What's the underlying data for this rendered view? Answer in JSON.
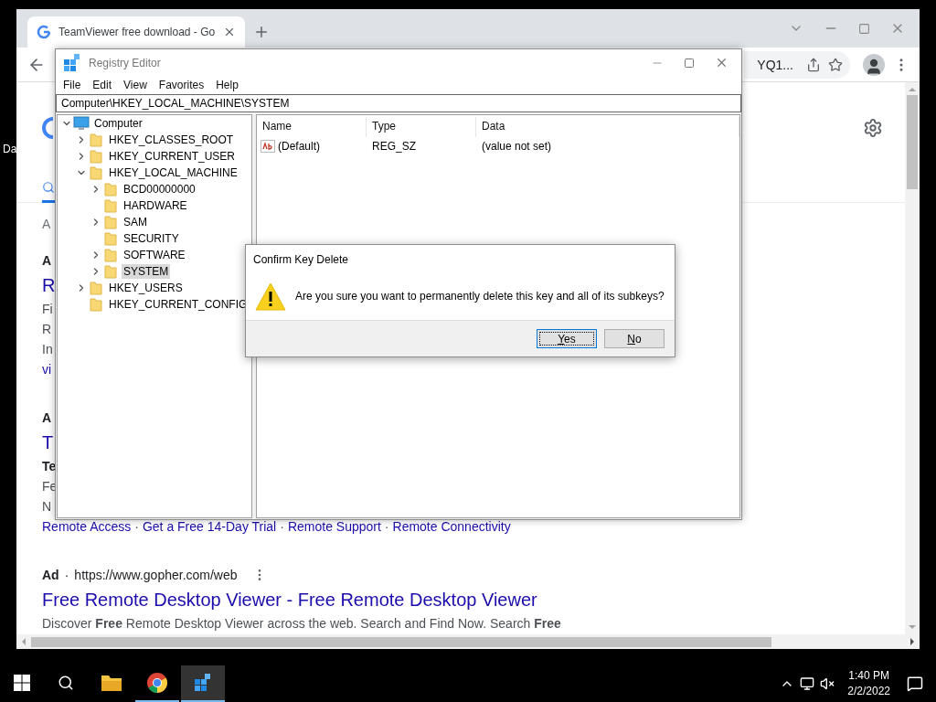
{
  "desktop": {
    "icon_labels": [
      "Da"
    ]
  },
  "browser": {
    "tab": {
      "title": "TeamViewer free download - Go",
      "selected": true
    },
    "address": "YQ1...",
    "page": {
      "summary": "A",
      "results": [
        {
          "ad_label": "A",
          "headline": "R",
          "lines": [
            {
              "kind": "text",
              "text": "Fi"
            },
            {
              "kind": "text",
              "text": "R"
            },
            {
              "kind": "text",
              "text": "In"
            },
            {
              "kind": "link",
              "text": "vi"
            }
          ]
        },
        {
          "ad_label": "A",
          "headline": "T",
          "lines": [
            {
              "kind": "bold",
              "text": "Te"
            },
            {
              "kind": "text",
              "text": "Fe"
            },
            {
              "kind": "text",
              "text": "N"
            },
            {
              "kind": "links",
              "separator": "·",
              "items": [
                "Remote Access",
                "Get a Free 14-Day Trial",
                "Remote Support",
                "Remote Connectivity"
              ]
            }
          ]
        },
        {
          "ad_label": "Ad",
          "separator": "·",
          "url": "https://www.gopher.com/web",
          "headline": "Free Remote Desktop Viewer - Free Remote Desktop Viewer",
          "lines": [
            {
              "kind": "text",
              "text": "Discover **Free** Remote Desktop Viewer across the web. Search and Find Now. Search **Free**"
            }
          ]
        }
      ]
    }
  },
  "regedit": {
    "title": "Registry Editor",
    "menu": [
      "File",
      "Edit",
      "View",
      "Favorites",
      "Help"
    ],
    "address": "Computer\\HKEY_LOCAL_MACHINE\\SYSTEM",
    "tree": [
      {
        "label": "Computer",
        "kind": "computer",
        "expandable": true,
        "expanded": true,
        "selected": false,
        "children": [
          {
            "label": "HKEY_CLASSES_ROOT",
            "kind": "folder",
            "expandable": true,
            "expanded": false,
            "selected": false
          },
          {
            "label": "HKEY_CURRENT_USER",
            "kind": "folder",
            "expandable": true,
            "expanded": false,
            "selected": false
          },
          {
            "label": "HKEY_LOCAL_MACHINE",
            "kind": "folder",
            "expandable": true,
            "expanded": true,
            "selected": false,
            "children": [
              {
                "label": "BCD00000000",
                "kind": "folder",
                "expandable": true,
                "expanded": false,
                "selected": false
              },
              {
                "label": "HARDWARE",
                "kind": "folder",
                "expandable": false,
                "selected": false
              },
              {
                "label": "SAM",
                "kind": "folder",
                "expandable": true,
                "expanded": false,
                "selected": false
              },
              {
                "label": "SECURITY",
                "kind": "folder",
                "expandable": false,
                "selected": false
              },
              {
                "label": "SOFTWARE",
                "kind": "folder",
                "expandable": true,
                "expanded": false,
                "selected": false
              },
              {
                "label": "SYSTEM",
                "kind": "folder",
                "expandable": true,
                "expanded": false,
                "selected": true
              }
            ]
          },
          {
            "label": "HKEY_USERS",
            "kind": "folder",
            "expandable": true,
            "expanded": false,
            "selected": false
          },
          {
            "label": "HKEY_CURRENT_CONFIG",
            "kind": "folder",
            "expandable": false,
            "selected": false
          }
        ]
      }
    ],
    "columns": [
      "Name",
      "Type",
      "Data"
    ],
    "values": [
      {
        "name": "(Default)",
        "type": "REG_SZ",
        "data": "(value not set)"
      }
    ]
  },
  "dialog": {
    "title": "Confirm Key Delete",
    "message": "Are you sure you want to permanently delete this key and all of its subkeys?",
    "buttons": [
      {
        "label": "Yes",
        "focused": true
      },
      {
        "label": "No",
        "focused": false
      }
    ]
  },
  "taskbar": {
    "apps": [
      {
        "kind": "explorer",
        "open": false,
        "active": false
      },
      {
        "kind": "chrome",
        "open": true,
        "active": false
      },
      {
        "kind": "regedit",
        "open": true,
        "active": true
      }
    ],
    "clock": {
      "time": "1:40 PM",
      "date": "2/2/2022"
    }
  }
}
